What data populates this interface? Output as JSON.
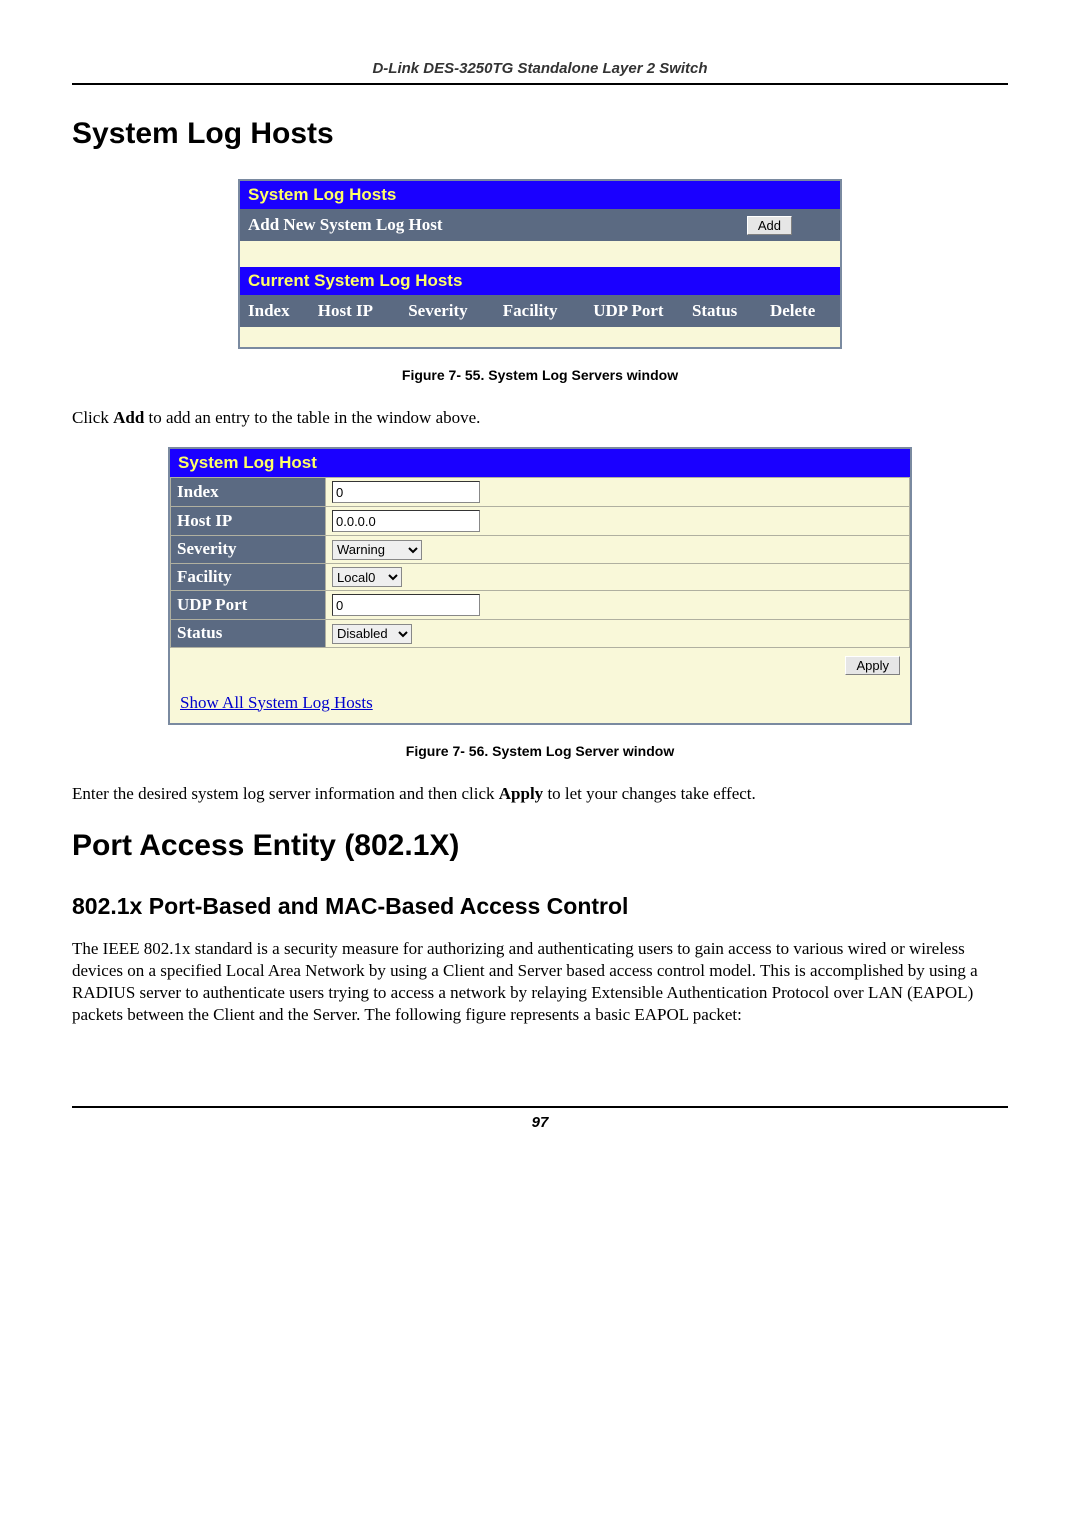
{
  "running_head": "D-Link DES-3250TG Standalone Layer 2 Switch",
  "section1_title": "System Log Hosts",
  "shot1": {
    "title": "System Log Hosts",
    "add_label": "Add New System Log Host",
    "add_btn": "Add",
    "current_title": "Current System Log Hosts",
    "cols": [
      "Index",
      "Host IP",
      "Severity",
      "Facility",
      "UDP Port",
      "Status",
      "Delete"
    ]
  },
  "caption1": "Figure 7- 55.  System Log Servers window",
  "para1_pre": "Click ",
  "para1_bold": "Add",
  "para1_post": " to add an entry to the table in the window above.",
  "shot2": {
    "title": "System Log Host",
    "rows": {
      "index_label": "Index",
      "index_value": "0",
      "hostip_label": "Host IP",
      "hostip_value": "0.0.0.0",
      "severity_label": "Severity",
      "severity_value": "Warning",
      "facility_label": "Facility",
      "facility_value": "Local0",
      "udp_label": "UDP Port",
      "udp_value": "0",
      "status_label": "Status",
      "status_value": "Disabled"
    },
    "apply_btn": "Apply",
    "link_text": "Show All System Log Hosts"
  },
  "caption2": "Figure 7- 56.  System Log Server window",
  "para2_pre": "Enter the desired system log server information and then click ",
  "para2_bold": "Apply",
  "para2_post": " to let your changes take effect.",
  "section2_title": "Port Access Entity (802.1X)",
  "subsection_title": "802.1x Port-Based and MAC-Based Access Control",
  "para3": "The IEEE 802.1x standard is a security measure for authorizing and authenticating users to gain access to various wired or wireless devices on a specified Local Area Network by using a Client and Server based access control model. This is accomplished by using a RADIUS server to authenticate users trying to access a network by relaying Extensible Authentication Protocol over LAN (EAPOL) packets between the Client and the Server. The following figure represents a basic EAPOL packet:",
  "page_number": "97"
}
